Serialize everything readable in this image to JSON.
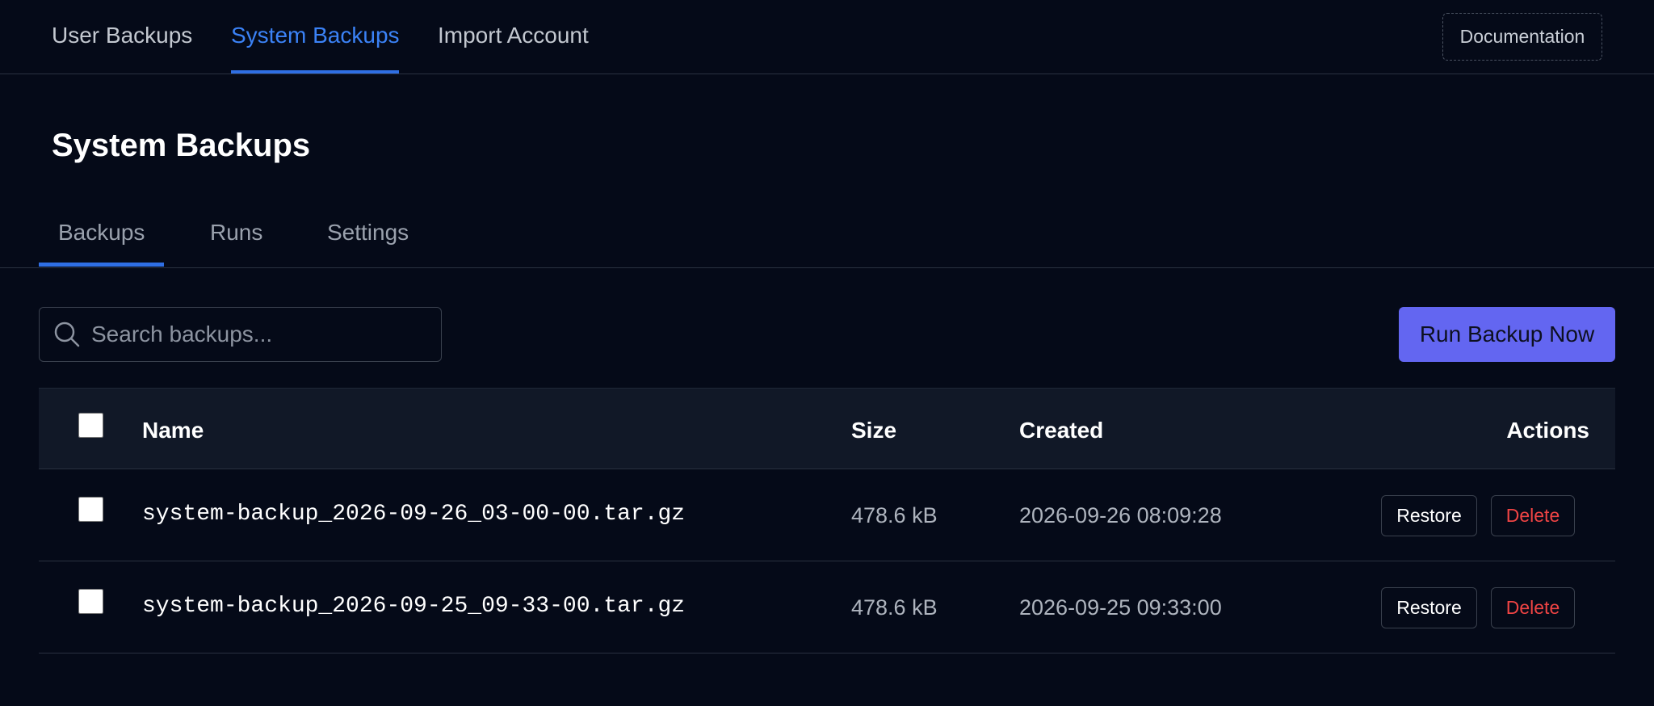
{
  "topnav": {
    "tabs": [
      {
        "label": "User Backups"
      },
      {
        "label": "System Backups",
        "active": true
      },
      {
        "label": "Import Account"
      }
    ],
    "documentation_label": "Documentation"
  },
  "page": {
    "title": "System Backups"
  },
  "subtabs": [
    {
      "label": "Backups",
      "active": true
    },
    {
      "label": "Runs"
    },
    {
      "label": "Settings"
    }
  ],
  "search": {
    "placeholder": "Search backups...",
    "value": "",
    "icon": "search-icon"
  },
  "run_button_label": "Run Backup Now",
  "table": {
    "columns": [
      "Name",
      "Size",
      "Created",
      "Actions"
    ],
    "rows": [
      {
        "name": "system-backup_2026-09-26_03-00-00.tar.gz",
        "size": "478.6 kB",
        "created": "2026-09-26 08:09:28",
        "restore_label": "Restore",
        "delete_label": "Delete",
        "checked": false
      },
      {
        "name": "system-backup_2026-09-25_09-33-00.tar.gz",
        "size": "478.6 kB",
        "created": "2026-09-25 09:33:00",
        "restore_label": "Restore",
        "delete_label": "Delete",
        "checked": false
      }
    ]
  },
  "colors": {
    "background": "#050a18",
    "accent": "#3b82f6",
    "primary_button": "#6366f1",
    "danger": "#ef4444",
    "table_header": "#111827"
  }
}
